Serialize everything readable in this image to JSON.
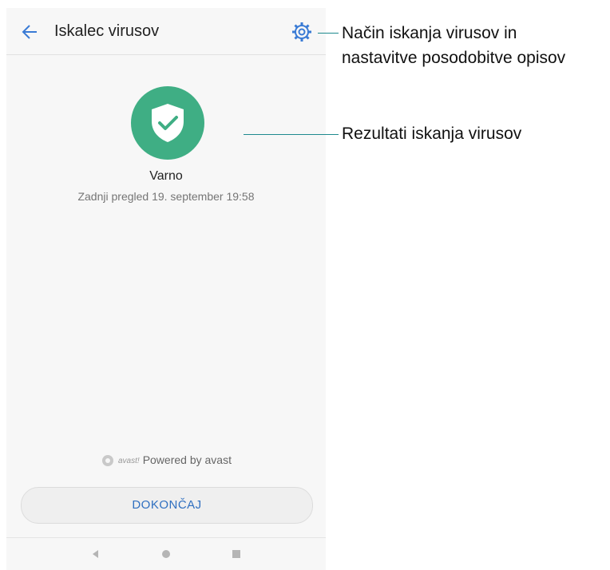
{
  "header": {
    "title": "Iskalec virusov"
  },
  "scan": {
    "status": "Varno",
    "last_scan": "Zadnji pregled 19. september 19:58"
  },
  "footer": {
    "brand": "avast!",
    "powered_by": "Powered by avast",
    "done_label": "DOKONČAJ"
  },
  "callouts": {
    "settings_line1": "Način iskanja virusov in",
    "settings_line2": "nastavitve posodobitve opisov",
    "results": "Rezultati iskanja virusov"
  },
  "colors": {
    "accent_green": "#3fae84",
    "link_blue": "#2f6fc0",
    "callout_line": "#1f8a8e"
  },
  "icons": [
    "back-arrow-icon",
    "gear-icon",
    "shield-check-icon",
    "avast-logo-icon",
    "nav-back-icon",
    "nav-home-icon",
    "nav-recents-icon"
  ]
}
